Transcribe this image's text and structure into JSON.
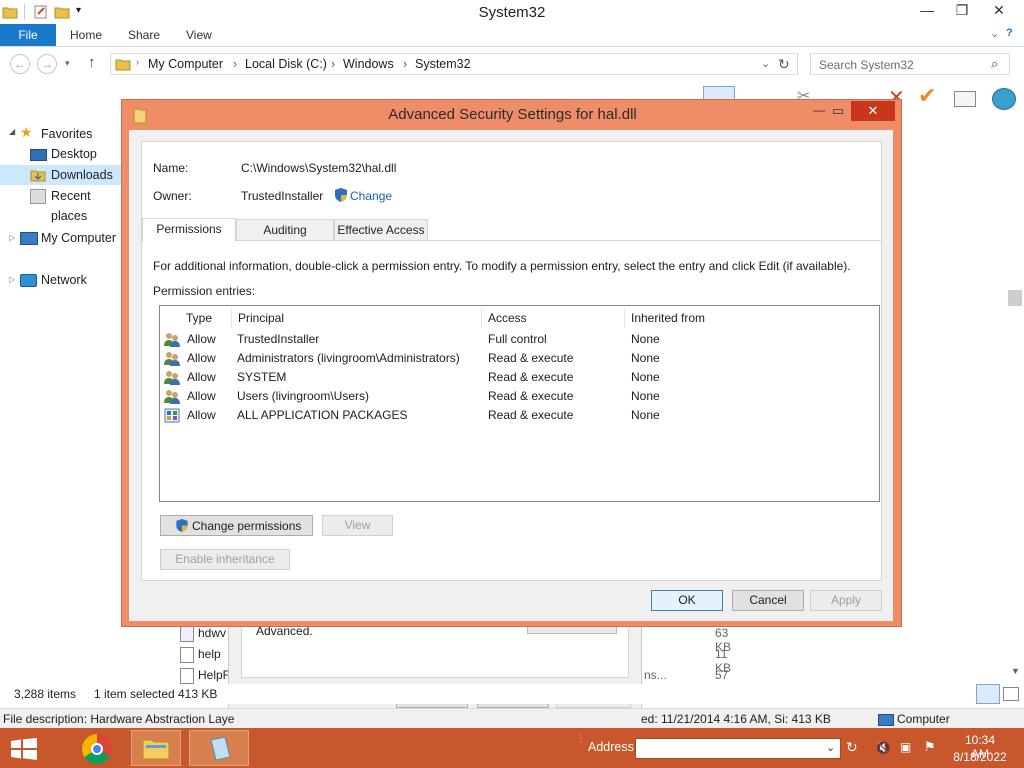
{
  "explorer": {
    "title": "System32",
    "ribbon_tabs": [
      "File",
      "Home",
      "Share",
      "View"
    ],
    "breadcrumb": [
      "My Computer",
      "Local Disk (C:)",
      "Windows",
      "System32"
    ],
    "search_placeholder": "Search System32",
    "nav": {
      "favorites": "Favorites",
      "desktop": "Desktop",
      "downloads": "Downloads",
      "recent": "Recent places",
      "my_computer": "My Computer",
      "network": "Network"
    },
    "files": [
      {
        "name": "hdwv",
        "size": "63 KB"
      },
      {
        "name": "help",
        "size": "11 KB"
      },
      {
        "name": "HelpF",
        "size": "57 KB"
      }
    ],
    "files_type_fragment": "ns...",
    "status": {
      "items": "3,288 items",
      "selected": "1 item selected",
      "size": "413 KB"
    },
    "description_bar": {
      "left": "File description: Hardware Abstraction Laye",
      "right": "ed: 11/21/2014 4:16 AM, Si: 413 KB",
      "computer": "Computer"
    }
  },
  "behind_dialog": {
    "advanced_text": "Advanced.",
    "ok": "OK",
    "cancel": "Cancel",
    "apply": "Apply"
  },
  "dialog": {
    "title": "Advanced Security Settings for hal.dll",
    "name_label": "Name:",
    "name_value": "C:\\Windows\\System32\\hal.dll",
    "owner_label": "Owner:",
    "owner_value": "TrustedInstaller",
    "change_link": "Change",
    "tabs": [
      "Permissions",
      "Auditing",
      "Effective Access"
    ],
    "info_text": "For additional information, double-click a permission entry. To modify a permission entry, select the entry and click Edit (if available).",
    "entries_label": "Permission entries:",
    "columns": [
      "Type",
      "Principal",
      "Access",
      "Inherited from"
    ],
    "rows": [
      {
        "type": "Allow",
        "principal": "TrustedInstaller",
        "access": "Full control",
        "inherited": "None",
        "icon": "users-icon"
      },
      {
        "type": "Allow",
        "principal": "Administrators (livingroom\\Administrators)",
        "access": "Read & execute",
        "inherited": "None",
        "icon": "users-icon"
      },
      {
        "type": "Allow",
        "principal": "SYSTEM",
        "access": "Read & execute",
        "inherited": "None",
        "icon": "users-icon"
      },
      {
        "type": "Allow",
        "principal": "Users (livingroom\\Users)",
        "access": "Read & execute",
        "inherited": "None",
        "icon": "users-icon"
      },
      {
        "type": "Allow",
        "principal": "ALL APPLICATION PACKAGES",
        "access": "Read & execute",
        "inherited": "None",
        "icon": "package-icon"
      }
    ],
    "change_permissions": "Change permissions",
    "view": "View",
    "enable_inheritance": "Enable inheritance",
    "ok": "OK",
    "cancel": "Cancel",
    "apply": "Apply"
  },
  "taskbar": {
    "address_label": "Address",
    "time": "10:34 AM",
    "date": "8/18/2022"
  },
  "colors": {
    "taskbar": "#c8582c",
    "dialog_frame": "#ee8d68",
    "close_button": "#c7361d",
    "file_tab": "#1979ca",
    "link": "#1a5fb4"
  }
}
